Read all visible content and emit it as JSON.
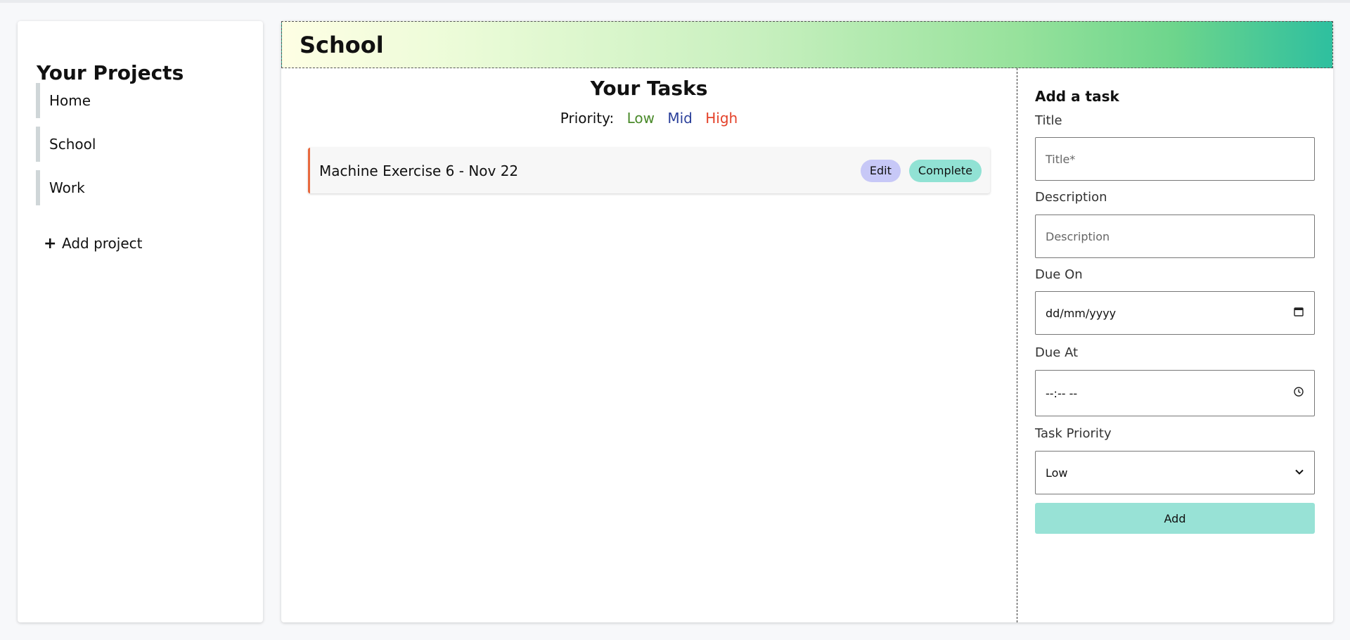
{
  "sidebar": {
    "title": "Your Projects",
    "projects": [
      {
        "label": "Home"
      },
      {
        "label": "School"
      },
      {
        "label": "Work"
      }
    ],
    "add_project_icon": "+",
    "add_project_label": "Add project"
  },
  "header": {
    "project_title": "School"
  },
  "tasks": {
    "title": "Your Tasks",
    "priority_label": "Priority:",
    "priority_low": "Low",
    "priority_mid": "Mid",
    "priority_high": "High",
    "priority_colors": {
      "low": "#4a8a2a",
      "mid": "#2a3f9a",
      "high": "#e4422a"
    },
    "items": [
      {
        "name": "Machine Exercise 6 - Nov 22",
        "edit_label": "Edit",
        "complete_label": "Complete",
        "priority": "High"
      }
    ]
  },
  "form": {
    "title": "Add a task",
    "title_label": "Title",
    "title_placeholder": "Title*",
    "description_label": "Description",
    "description_placeholder": "Description",
    "due_on_label": "Due On",
    "due_on_value": "dd/mm/yyyy",
    "due_on_icon": "calendar-icon",
    "due_at_label": "Due At",
    "due_at_value": "--:-- --",
    "due_at_icon": "clock-icon",
    "priority_label": "Task Priority",
    "priority_value": "Low",
    "add_label": "Add"
  }
}
